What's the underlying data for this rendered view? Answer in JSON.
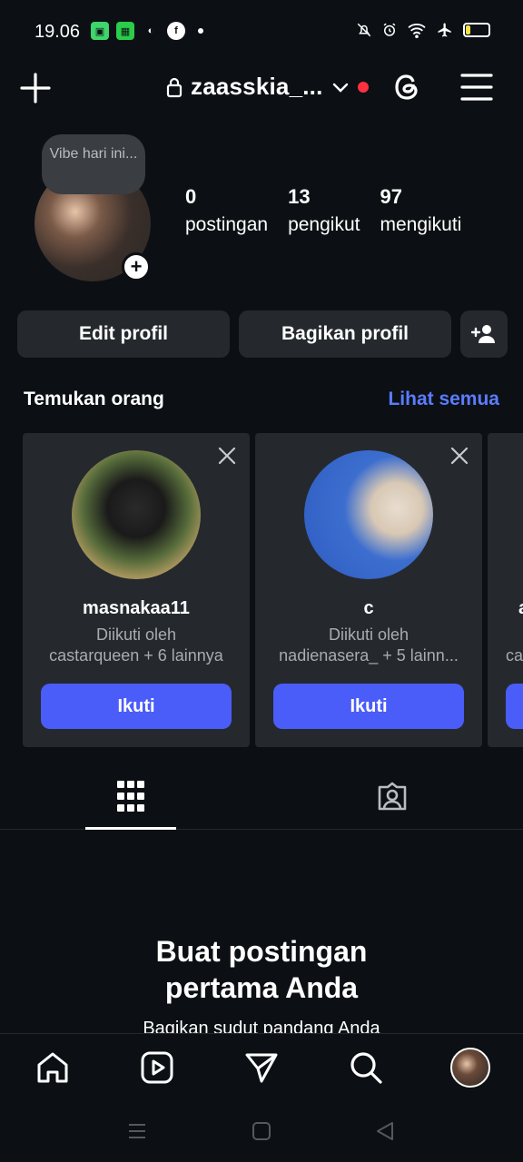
{
  "status_bar": {
    "time": "19.06",
    "battery": "20",
    "battery_level": 0.2,
    "left_icons": [
      "evernote-icon",
      "store-icon",
      "line-icon",
      "facebook-icon"
    ],
    "right_icons": [
      "mute-icon",
      "alarm-icon",
      "wifi-icon",
      "airplane-icon"
    ]
  },
  "header": {
    "username": "zaasskia_...",
    "has_notification_dot": true
  },
  "profile": {
    "note": "Vibe hari ini...",
    "stats": [
      {
        "value": "0",
        "label": "postingan"
      },
      {
        "value": "13",
        "label": "pengikut"
      },
      {
        "value": "97",
        "label": "mengikuti"
      }
    ],
    "edit_button": "Edit profil",
    "share_button": "Bagikan profil"
  },
  "suggestions": {
    "title": "Temukan orang",
    "see_all": "Lihat semua",
    "cards": [
      {
        "username": "masnakaa11",
        "line1": "Diikuti oleh",
        "line2": "castarqueen + 6 lainnya",
        "follow": "Ikuti"
      },
      {
        "username": "c",
        "line1": "Diikuti oleh",
        "line2": "nadienasera_ + 5 lainn...",
        "follow": "Ikuti"
      },
      {
        "username": "a",
        "line1": "",
        "line2": "ca",
        "follow": ""
      }
    ]
  },
  "tabs": [
    "grid-icon",
    "tagged-icon"
  ],
  "empty_state": {
    "title_line1": "Buat postingan",
    "title_line2": "pertama Anda",
    "subtitle": "Bagikan sudut pandang Anda"
  },
  "bottom_nav": [
    "home-icon",
    "reels-icon",
    "send-icon",
    "search-icon",
    "profile-avatar"
  ],
  "colors": {
    "background": "#0c1014",
    "button_bg": "#25292e",
    "accent_blue": "#4a5df9",
    "link_blue": "#5b7cff",
    "notification_red": "#ff3040"
  }
}
